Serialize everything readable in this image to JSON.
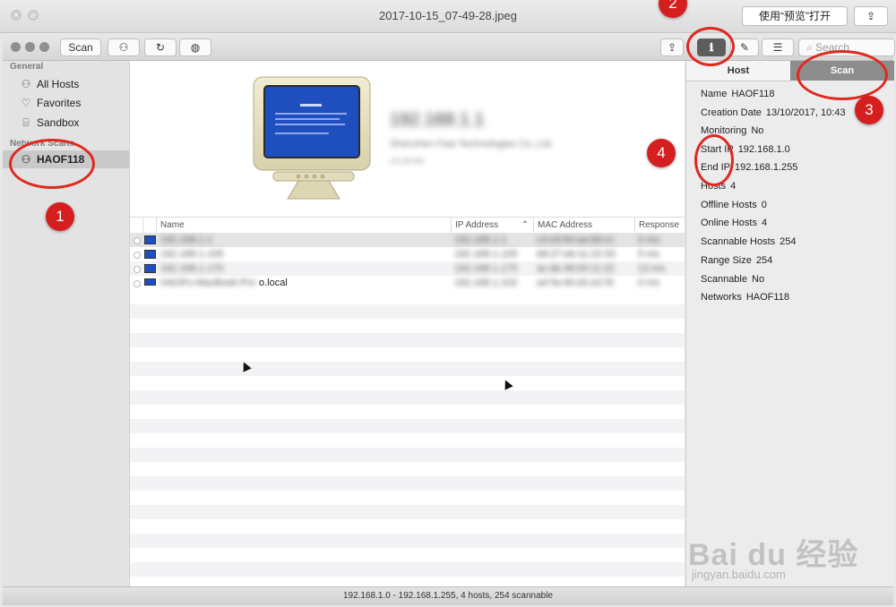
{
  "window": {
    "title": "2017-10-15_07-49-28.jpeg",
    "open_with_button": "使用“预览”打开",
    "share_icon": "share-icon"
  },
  "toolbar": {
    "scan_button": "Scan",
    "search_placeholder": "Search"
  },
  "sidebar": {
    "general_header": "General",
    "items": [
      {
        "label": "All Hosts",
        "icon": "network-icon"
      },
      {
        "label": "Favorites",
        "icon": "heart-icon"
      },
      {
        "label": "Sandbox",
        "icon": "sandbox-icon"
      }
    ],
    "network_scans_header": "Network Scans",
    "scans": [
      {
        "label": "HAOF118",
        "icon": "network-icon",
        "selected": true
      }
    ]
  },
  "host_header": {
    "name": "192.168.1.1",
    "vendor": "Shenzhen Fast Technologies Co.,Ltd.",
    "extra": "c4:e9:84"
  },
  "table": {
    "columns": [
      "Name",
      "IP Address",
      "MAC Address",
      "Response"
    ],
    "rows": [
      {
        "name": "192.168.1.1",
        "ip": "192.168.1.1",
        "mac": "c4:e9:84:aa:bb:cc",
        "response": "4 ms"
      },
      {
        "name": "192.168.1.105",
        "ip": "192.168.1.105",
        "mac": "b8:27:eb:11:22:33",
        "response": "5 ms"
      },
      {
        "name": "192.168.1.170",
        "ip": "192.168.1.170",
        "mac": "ac:de:48:00:11:22",
        "response": "13 ms"
      },
      {
        "name_hidden": "HAOFs-MacBook-Pro",
        "name_visible": "o.local",
        "ip": "192.168.1.102",
        "mac": "a4:5e:60:d1:e2:f3",
        "response": "0 ms"
      }
    ]
  },
  "inspector": {
    "tab_host": "Host",
    "tab_scan": "Scan",
    "properties": [
      {
        "label": "Name",
        "value": "HAOF118"
      },
      {
        "label": "Creation Date",
        "value": "13/10/2017, 10:43"
      },
      {
        "label": "Monitoring",
        "value": "No"
      },
      {
        "label": "Start IP",
        "value": "192.168.1.0"
      },
      {
        "label": "End IP",
        "value": "192.168.1.255"
      },
      {
        "label": "Hosts",
        "value": "4"
      },
      {
        "label": "Offline Hosts",
        "value": "0"
      },
      {
        "label": "Online Hosts",
        "value": "4"
      },
      {
        "label": "Scannable Hosts",
        "value": "254"
      },
      {
        "label": "Range Size",
        "value": "254"
      },
      {
        "label": "Scannable",
        "value": "No"
      },
      {
        "label": "Networks",
        "value": "HAOF118"
      }
    ]
  },
  "status": {
    "text": "192.168.1.0 - 192.168.1.255, 4 hosts, 254 scannable"
  },
  "annotations": {
    "badges": [
      "1",
      "2",
      "3",
      "4"
    ],
    "color": "#e0281f"
  },
  "watermark": {
    "logo": "Bai du 经验",
    "url": "jingyan.baidu.com"
  },
  "colors": {
    "selected_tab": "#8d8d8d",
    "screen_blue": "#1f4fbf"
  }
}
